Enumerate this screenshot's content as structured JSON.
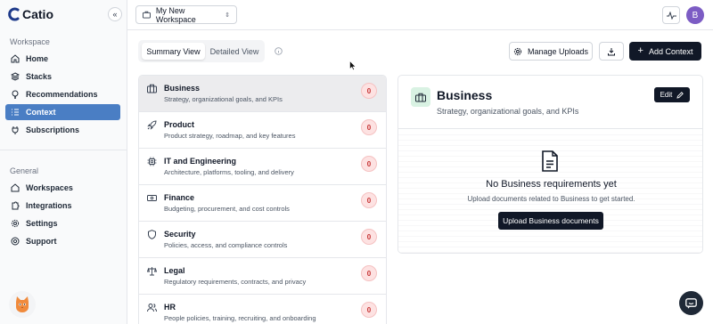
{
  "brand": {
    "name": "Catio"
  },
  "sidebar": {
    "workspace_label": "Workspace",
    "general_label": "General",
    "workspace_items": [
      {
        "label": "Home",
        "icon": "home-icon"
      },
      {
        "label": "Stacks",
        "icon": "layers-icon"
      },
      {
        "label": "Recommendations",
        "icon": "lightbulb-icon"
      },
      {
        "label": "Context",
        "icon": "list-icon",
        "active": true
      },
      {
        "label": "Subscriptions",
        "icon": "plug-icon"
      }
    ],
    "general_items": [
      {
        "label": "Workspaces",
        "icon": "building-icon"
      },
      {
        "label": "Integrations",
        "icon": "puzzle-icon"
      },
      {
        "label": "Settings",
        "icon": "gear-icon"
      },
      {
        "label": "Support",
        "icon": "lifebuoy-icon"
      }
    ]
  },
  "topbar": {
    "workspace": "My New Workspace",
    "avatar_initial": "B"
  },
  "toolbar": {
    "tabs": [
      "Summary View",
      "Detailed View"
    ],
    "active_tab": "Summary View",
    "manage_uploads": "Manage Uploads",
    "add_context": "Add Context"
  },
  "categories": [
    {
      "title": "Business",
      "desc": "Strategy, organizational goals, and KPIs",
      "count": "0",
      "icon": "briefcase-icon",
      "active": true
    },
    {
      "title": "Product",
      "desc": "Product strategy, roadmap, and key features",
      "count": "0",
      "icon": "rocket-icon"
    },
    {
      "title": "IT and Engineering",
      "desc": "Architecture, platforms, tooling, and delivery",
      "count": "0",
      "icon": "chip-icon"
    },
    {
      "title": "Finance",
      "desc": "Budgeting, procurement, and cost controls",
      "count": "0",
      "icon": "banknote-icon"
    },
    {
      "title": "Security",
      "desc": "Policies, access, and compliance controls",
      "count": "0",
      "icon": "shield-icon"
    },
    {
      "title": "Legal",
      "desc": "Regulatory requirements, contracts, and privacy",
      "count": "0",
      "icon": "scale-icon"
    },
    {
      "title": "HR",
      "desc": "People policies, training, recruiting, and onboarding",
      "count": "0",
      "icon": "users-icon"
    }
  ],
  "detail": {
    "title": "Business",
    "subtitle": "Strategy, organizational goals, and KPIs",
    "edit_label": "Edit",
    "empty_title": "No Business requirements yet",
    "empty_sub": "Upload documents related to Business to get started.",
    "upload_label": "Upload Business documents"
  },
  "colors": {
    "accent": "#4a7ec4",
    "dark": "#111827",
    "badge_bg": "#fde2e2",
    "badge_text": "#c53030",
    "avatar": "#7c5cc4"
  }
}
